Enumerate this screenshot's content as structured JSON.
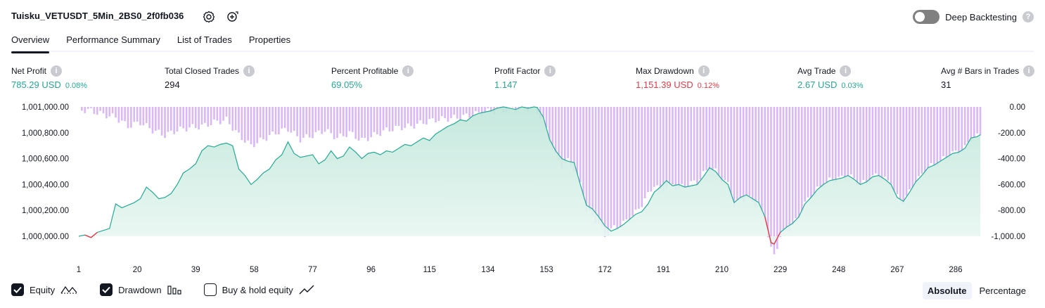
{
  "header": {
    "strategy_title": "Tuisku_VETUSDT_5Min_2BS0_2f0fb036",
    "deep_backtesting_label": "Deep Backtesting",
    "help_glyph": "?"
  },
  "tabs": [
    {
      "label": "Overview"
    },
    {
      "label": "Performance Summary"
    },
    {
      "label": "List of Trades"
    },
    {
      "label": "Properties"
    }
  ],
  "metrics": {
    "net_profit": {
      "label": "Net Profit",
      "value": "785.29 USD",
      "pct": "0.08%"
    },
    "total_closed_trades": {
      "label": "Total Closed Trades",
      "value": "294"
    },
    "percent_profitable": {
      "label": "Percent Profitable",
      "value": "69.05%"
    },
    "profit_factor": {
      "label": "Profit Factor",
      "value": "1.147"
    },
    "max_drawdown": {
      "label": "Max Drawdown",
      "value": "1,151.39 USD",
      "pct": "0.12%"
    },
    "avg_trade": {
      "label": "Avg Trade",
      "value": "2.67 USD",
      "pct": "0.03%"
    },
    "avg_bars": {
      "label": "Avg # Bars in Trades",
      "value": "31"
    }
  },
  "colors": {
    "positive": "#22ab94",
    "negative": "#f23645",
    "equity_line": "#22ab94",
    "equity_fill": "#d6f0e8",
    "drawdown_bar": "#d9b8f5",
    "text": "#131722"
  },
  "chart_data": {
    "type": "area",
    "x_ticks": [
      "1",
      "20",
      "39",
      "58",
      "77",
      "96",
      "115",
      "134",
      "153",
      "172",
      "191",
      "210",
      "229",
      "248",
      "267",
      "286"
    ],
    "left_axis": {
      "ticks": [
        "1,001,000.00",
        "1,000,800.00",
        "1,000,600.00",
        "1,000,400.00",
        "1,000,200.00",
        "1,000,000.00"
      ],
      "range": [
        1000000,
        1001000
      ]
    },
    "right_axis": {
      "ticks": [
        "0.00",
        "-200.00",
        "-400.00",
        "-600.00",
        "-800.00",
        "-1,000.00"
      ],
      "range": [
        -1000,
        0
      ]
    },
    "x_range": [
      1,
      294
    ],
    "series": [
      {
        "name": "Equity",
        "axis": "left",
        "points": [
          [
            1,
            1000000
          ],
          [
            3,
            1000010
          ],
          [
            5,
            999990
          ],
          [
            7,
            1000030
          ],
          [
            9,
            1000045
          ],
          [
            11,
            1000060
          ],
          [
            13,
            1000250
          ],
          [
            15,
            1000220
          ],
          [
            17,
            1000240
          ],
          [
            19,
            1000260
          ],
          [
            21,
            1000290
          ],
          [
            23,
            1000380
          ],
          [
            25,
            1000340
          ],
          [
            27,
            1000290
          ],
          [
            29,
            1000300
          ],
          [
            31,
            1000330
          ],
          [
            33,
            1000400
          ],
          [
            35,
            1000490
          ],
          [
            37,
            1000520
          ],
          [
            39,
            1000560
          ],
          [
            41,
            1000660
          ],
          [
            43,
            1000700
          ],
          [
            45,
            1000690
          ],
          [
            47,
            1000710
          ],
          [
            49,
            1000720
          ],
          [
            51,
            1000700
          ],
          [
            53,
            1000520
          ],
          [
            55,
            1000470
          ],
          [
            57,
            1000400
          ],
          [
            59,
            1000440
          ],
          [
            61,
            1000490
          ],
          [
            63,
            1000520
          ],
          [
            65,
            1000590
          ],
          [
            67,
            1000630
          ],
          [
            69,
            1000730
          ],
          [
            71,
            1000640
          ],
          [
            73,
            1000610
          ],
          [
            75,
            1000620
          ],
          [
            77,
            1000630
          ],
          [
            79,
            1000560
          ],
          [
            81,
            1000590
          ],
          [
            83,
            1000660
          ],
          [
            85,
            1000600
          ],
          [
            87,
            1000620
          ],
          [
            89,
            1000690
          ],
          [
            91,
            1000650
          ],
          [
            93,
            1000600
          ],
          [
            95,
            1000640
          ],
          [
            97,
            1000650
          ],
          [
            99,
            1000630
          ],
          [
            101,
            1000660
          ],
          [
            103,
            1000650
          ],
          [
            105,
            1000680
          ],
          [
            107,
            1000710
          ],
          [
            109,
            1000700
          ],
          [
            111,
            1000730
          ],
          [
            113,
            1000760
          ],
          [
            115,
            1000740
          ],
          [
            117,
            1000790
          ],
          [
            119,
            1000820
          ],
          [
            121,
            1000850
          ],
          [
            123,
            1000870
          ],
          [
            125,
            1000900
          ],
          [
            127,
            1000890
          ],
          [
            129,
            1000930
          ],
          [
            131,
            1000950
          ],
          [
            133,
            1000960
          ],
          [
            135,
            1000970
          ],
          [
            137,
            1000990
          ],
          [
            139,
            1001000
          ],
          [
            141,
            1000990
          ],
          [
            143,
            1000980
          ],
          [
            145,
            1001000
          ],
          [
            147,
            1000990
          ],
          [
            149,
            1001000
          ],
          [
            150,
            1000995
          ],
          [
            152,
            1000920
          ],
          [
            154,
            1000750
          ],
          [
            156,
            1000660
          ],
          [
            158,
            1000600
          ],
          [
            160,
            1000580
          ],
          [
            162,
            1000570
          ],
          [
            164,
            1000400
          ],
          [
            166,
            1000240
          ],
          [
            168,
            1000210
          ],
          [
            170,
            1000150
          ],
          [
            172,
            1000080
          ],
          [
            174,
            1000040
          ],
          [
            176,
            1000060
          ],
          [
            178,
            1000090
          ],
          [
            180,
            1000130
          ],
          [
            182,
            1000170
          ],
          [
            184,
            1000190
          ],
          [
            186,
            1000250
          ],
          [
            188,
            1000340
          ],
          [
            190,
            1000380
          ],
          [
            192,
            1000430
          ],
          [
            194,
            1000390
          ],
          [
            196,
            1000400
          ],
          [
            198,
            1000380
          ],
          [
            200,
            1000390
          ],
          [
            202,
            1000400
          ],
          [
            204,
            1000460
          ],
          [
            206,
            1000530
          ],
          [
            208,
            1000500
          ],
          [
            210,
            1000440
          ],
          [
            212,
            1000400
          ],
          [
            214,
            1000260
          ],
          [
            216,
            1000300
          ],
          [
            218,
            1000320
          ],
          [
            220,
            1000290
          ],
          [
            222,
            1000260
          ],
          [
            224,
            1000150
          ],
          [
            226,
            999950
          ],
          [
            227,
            999940
          ],
          [
            229,
            1000030
          ],
          [
            231,
            1000070
          ],
          [
            233,
            1000100
          ],
          [
            235,
            1000150
          ],
          [
            237,
            1000250
          ],
          [
            239,
            1000300
          ],
          [
            241,
            1000360
          ],
          [
            243,
            1000400
          ],
          [
            245,
            1000430
          ],
          [
            247,
            1000440
          ],
          [
            249,
            1000450
          ],
          [
            251,
            1000470
          ],
          [
            253,
            1000440
          ],
          [
            255,
            1000400
          ],
          [
            257,
            1000420
          ],
          [
            259,
            1000460
          ],
          [
            261,
            1000470
          ],
          [
            263,
            1000440
          ],
          [
            265,
            1000400
          ],
          [
            267,
            1000300
          ],
          [
            269,
            1000270
          ],
          [
            271,
            1000340
          ],
          [
            273,
            1000420
          ],
          [
            275,
            1000470
          ],
          [
            277,
            1000530
          ],
          [
            279,
            1000550
          ],
          [
            281,
            1000580
          ],
          [
            283,
            1000610
          ],
          [
            285,
            1000640
          ],
          [
            287,
            1000650
          ],
          [
            289,
            1000680
          ],
          [
            291,
            1000760
          ],
          [
            293,
            1000770
          ],
          [
            294,
            1000785
          ]
        ]
      },
      {
        "name": "Drawdown",
        "axis": "right",
        "points": [
          [
            1,
            -20
          ],
          [
            5,
            -30
          ],
          [
            9,
            -60
          ],
          [
            13,
            -80
          ],
          [
            17,
            -150
          ],
          [
            21,
            -120
          ],
          [
            25,
            -180
          ],
          [
            29,
            -220
          ],
          [
            33,
            -180
          ],
          [
            37,
            -160
          ],
          [
            41,
            -150
          ],
          [
            45,
            -120
          ],
          [
            49,
            -100
          ],
          [
            53,
            -220
          ],
          [
            57,
            -300
          ],
          [
            61,
            -250
          ],
          [
            65,
            -200
          ],
          [
            69,
            -170
          ],
          [
            73,
            -250
          ],
          [
            77,
            -220
          ],
          [
            81,
            -180
          ],
          [
            85,
            -240
          ],
          [
            89,
            -200
          ],
          [
            93,
            -260
          ],
          [
            97,
            -220
          ],
          [
            101,
            -180
          ],
          [
            105,
            -160
          ],
          [
            109,
            -150
          ],
          [
            113,
            -120
          ],
          [
            117,
            -100
          ],
          [
            121,
            -90
          ],
          [
            125,
            -80
          ],
          [
            129,
            -60
          ],
          [
            133,
            -40
          ],
          [
            137,
            -30
          ],
          [
            141,
            -20
          ],
          [
            145,
            -5
          ],
          [
            149,
            -10
          ],
          [
            152,
            -100
          ],
          [
            154,
            -250
          ],
          [
            156,
            -380
          ],
          [
            158,
            -450
          ],
          [
            160,
            -420
          ],
          [
            162,
            -480
          ],
          [
            164,
            -600
          ],
          [
            166,
            -800
          ],
          [
            168,
            -850
          ],
          [
            170,
            -900
          ],
          [
            172,
            -1000
          ],
          [
            174,
            -950
          ],
          [
            176,
            -920
          ],
          [
            178,
            -900
          ],
          [
            180,
            -860
          ],
          [
            182,
            -820
          ],
          [
            184,
            -750
          ],
          [
            186,
            -680
          ],
          [
            188,
            -600
          ],
          [
            190,
            -650
          ],
          [
            192,
            -620
          ],
          [
            194,
            -600
          ],
          [
            196,
            -630
          ],
          [
            198,
            -610
          ],
          [
            200,
            -590
          ],
          [
            202,
            -580
          ],
          [
            204,
            -520
          ],
          [
            206,
            -470
          ],
          [
            208,
            -500
          ],
          [
            210,
            -560
          ],
          [
            212,
            -600
          ],
          [
            214,
            -760
          ],
          [
            216,
            -720
          ],
          [
            218,
            -700
          ],
          [
            220,
            -730
          ],
          [
            222,
            -780
          ],
          [
            224,
            -880
          ],
          [
            226,
            -1100
          ],
          [
            227,
            -1151
          ],
          [
            229,
            -1000
          ],
          [
            231,
            -960
          ],
          [
            233,
            -920
          ],
          [
            235,
            -850
          ],
          [
            237,
            -750
          ],
          [
            239,
            -680
          ],
          [
            241,
            -640
          ],
          [
            243,
            -600
          ],
          [
            245,
            -570
          ],
          [
            247,
            -560
          ],
          [
            249,
            -550
          ],
          [
            251,
            -530
          ],
          [
            253,
            -560
          ],
          [
            255,
            -600
          ],
          [
            257,
            -580
          ],
          [
            259,
            -540
          ],
          [
            261,
            -530
          ],
          [
            263,
            -560
          ],
          [
            265,
            -600
          ],
          [
            267,
            -700
          ],
          [
            269,
            -730
          ],
          [
            271,
            -660
          ],
          [
            273,
            -580
          ],
          [
            275,
            -530
          ],
          [
            277,
            -470
          ],
          [
            279,
            -450
          ],
          [
            281,
            -420
          ],
          [
            283,
            -390
          ],
          [
            285,
            -360
          ],
          [
            287,
            -350
          ],
          [
            289,
            -320
          ],
          [
            291,
            -240
          ],
          [
            293,
            -230
          ],
          [
            294,
            -215
          ]
        ]
      }
    ],
    "grid": false
  },
  "legend": {
    "equity_label": "Equity",
    "drawdown_label": "Drawdown",
    "buyhold_label": "Buy & hold equity"
  },
  "mode": {
    "absolute_label": "Absolute",
    "percentage_label": "Percentage"
  }
}
